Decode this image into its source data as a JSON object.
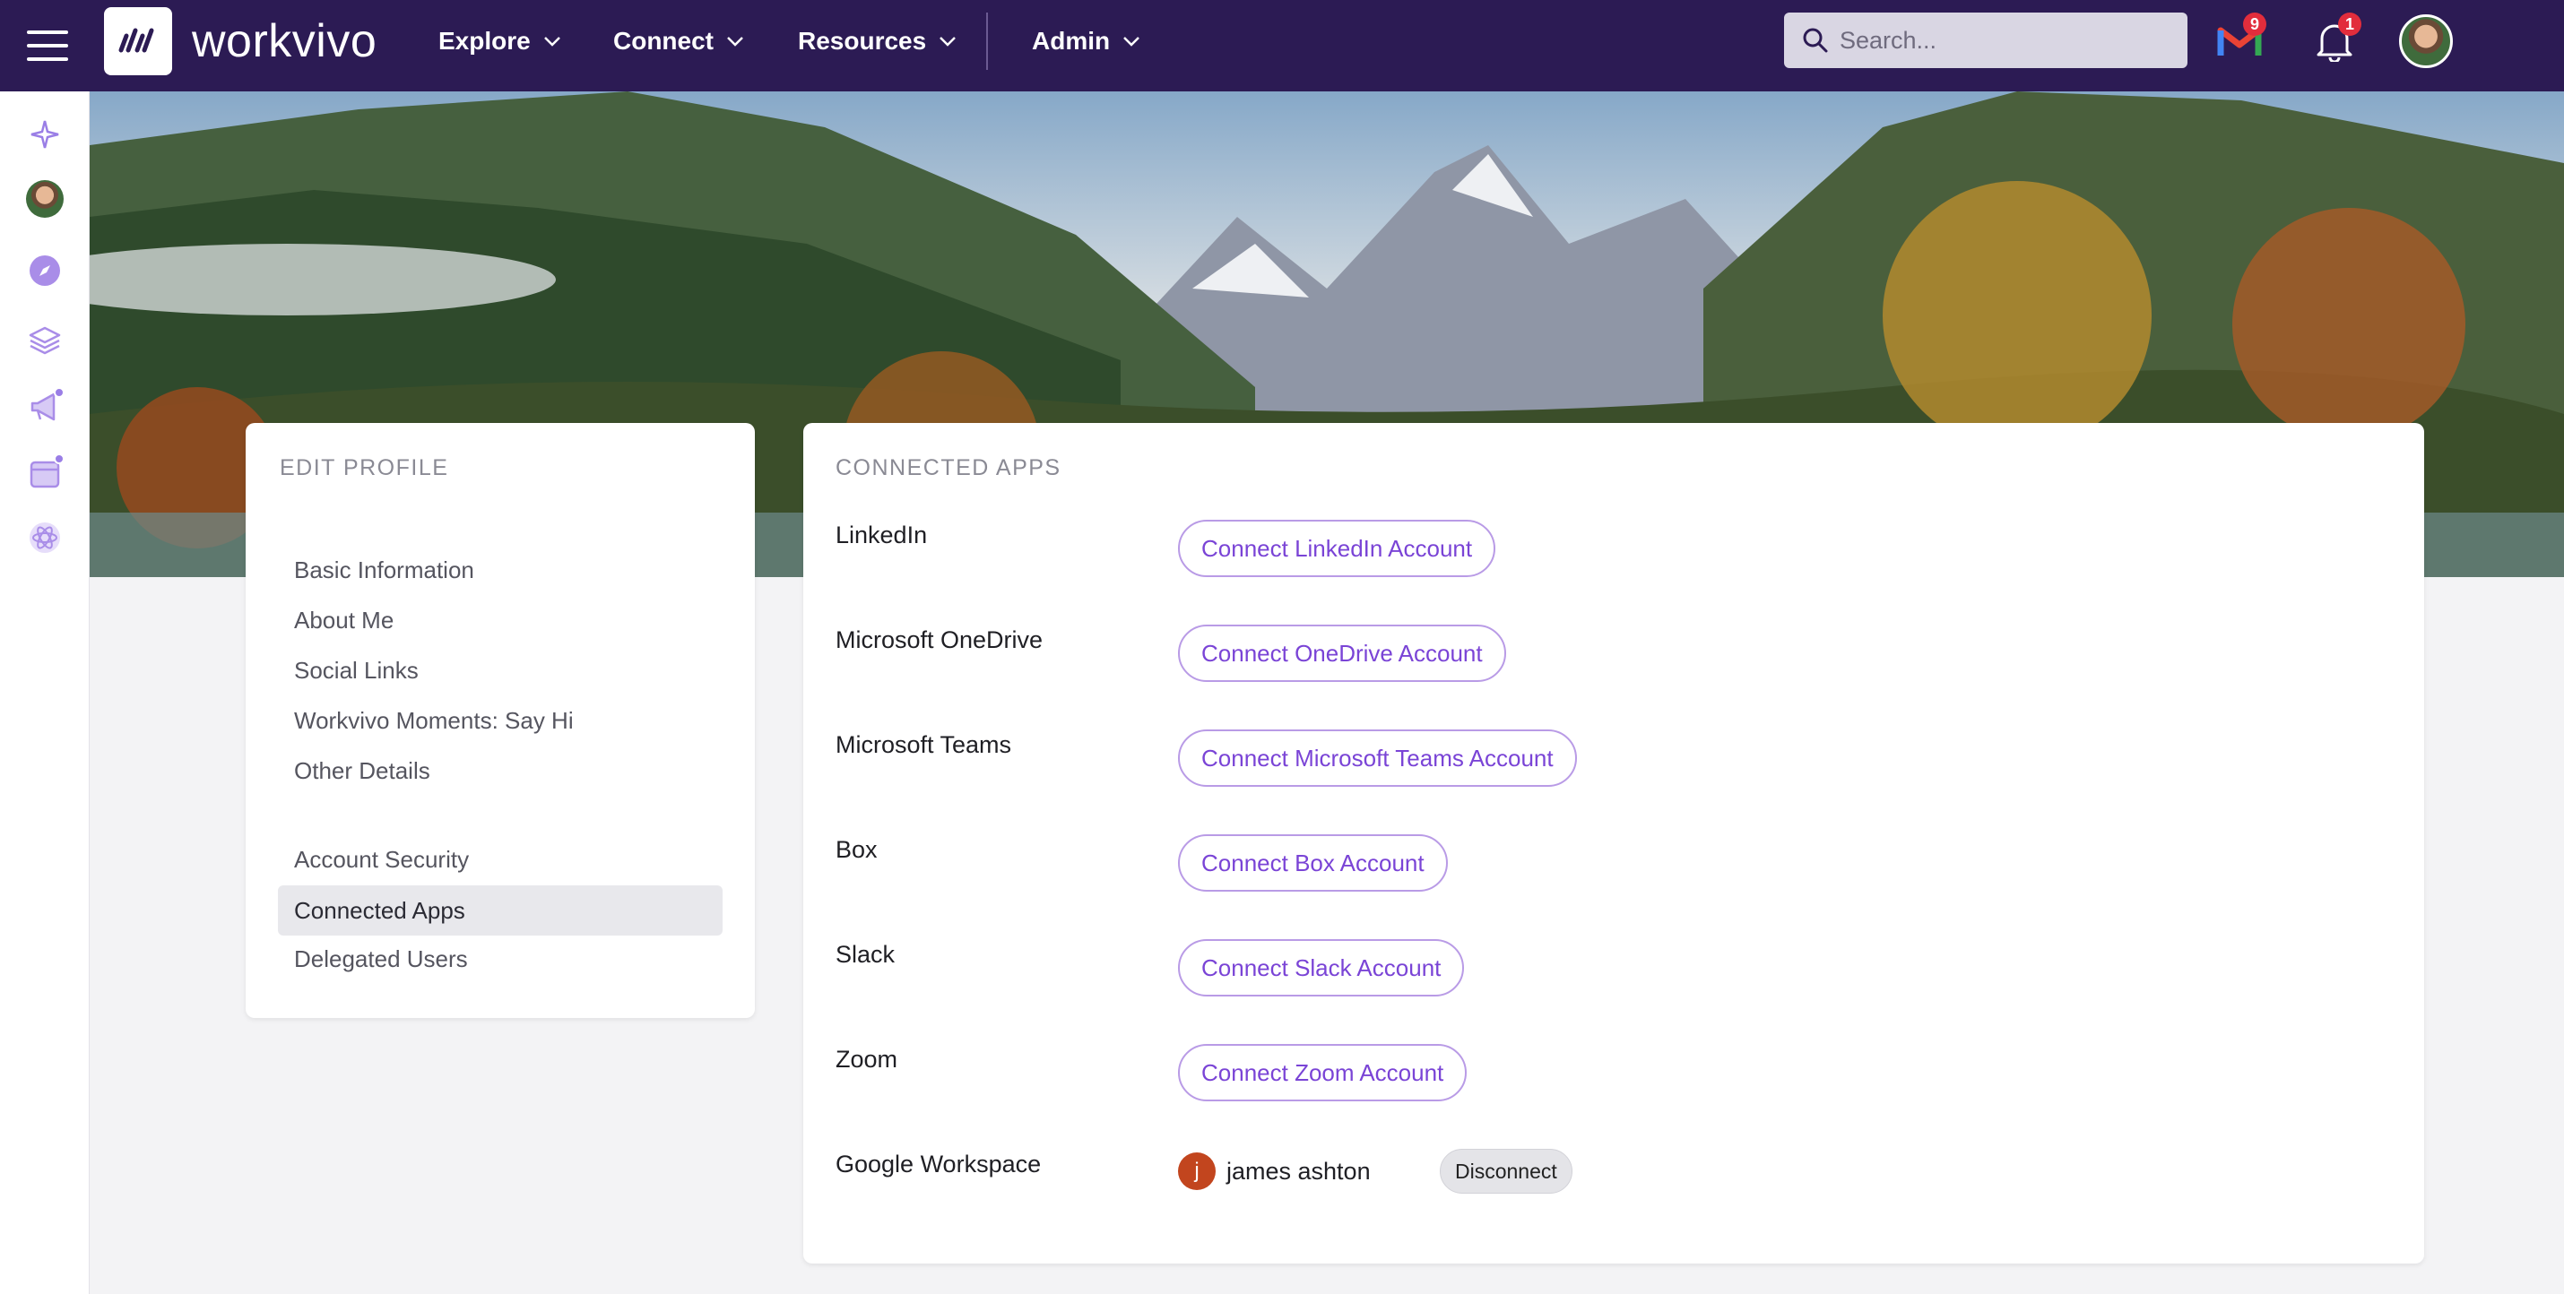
{
  "app": {
    "logo_text": "workvivo",
    "colors": {
      "nav_bg": "#2c1b54",
      "accent": "#7a44d6",
      "badge": "#e22d3c"
    }
  },
  "nav": {
    "items": [
      {
        "label": "Explore"
      },
      {
        "label": "Connect"
      },
      {
        "label": "Resources"
      },
      {
        "label": "Admin"
      }
    ],
    "search_placeholder": "Search...",
    "gmail_badge": "9",
    "notifications_badge": "1"
  },
  "sidebar": {
    "icons": [
      "sparkle-icon",
      "avatar",
      "compass-icon",
      "layers-icon",
      "megaphone-icon",
      "calendar-icon",
      "atom-icon"
    ]
  },
  "edit_profile": {
    "title": "EDIT PROFILE",
    "group1": [
      "Basic Information",
      "About Me",
      "Social Links",
      "Workvivo Moments: Say Hi",
      "Other Details"
    ],
    "group2": [
      "Account Security",
      "Connected Apps",
      "Delegated Users"
    ],
    "active": "Connected Apps"
  },
  "connected_apps": {
    "title": "CONNECTED APPS",
    "apps": [
      {
        "name": "LinkedIn",
        "button": "Connect LinkedIn Account"
      },
      {
        "name": "Microsoft OneDrive",
        "button": "Connect OneDrive Account"
      },
      {
        "name": "Microsoft Teams",
        "button": "Connect Microsoft Teams Account"
      },
      {
        "name": "Box",
        "button": "Connect Box Account"
      },
      {
        "name": "Slack",
        "button": "Connect Slack Account"
      },
      {
        "name": "Zoom",
        "button": "Connect Zoom Account"
      }
    ],
    "google": {
      "name": "Google Workspace",
      "account_initial": "j",
      "account_name": "james ashton",
      "disconnect": "Disconnect"
    }
  }
}
